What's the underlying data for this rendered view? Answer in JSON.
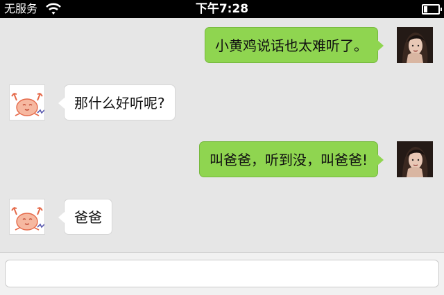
{
  "status_bar": {
    "carrier": "无服务",
    "time": "下午7:28",
    "battery_level": 0.25
  },
  "messages": [
    {
      "side": "right",
      "avatar": "woman-photo-avatar",
      "text": "小黄鸡说话也太难听了。"
    },
    {
      "side": "left",
      "avatar": "crab-avatar",
      "text": "那什么好听呢?"
    },
    {
      "side": "right",
      "avatar": "woman-photo-avatar",
      "text": "叫爸爸，听到没，叫爸爸!"
    },
    {
      "side": "left",
      "avatar": "crab-avatar",
      "text": "爸爸"
    }
  ],
  "composer": {
    "value": "",
    "placeholder": ""
  },
  "colors": {
    "status_bar_bg": "#000000",
    "chat_bg": "#e6e6e6",
    "outgoing_bubble": "#8fd550",
    "incoming_bubble": "#ffffff"
  }
}
